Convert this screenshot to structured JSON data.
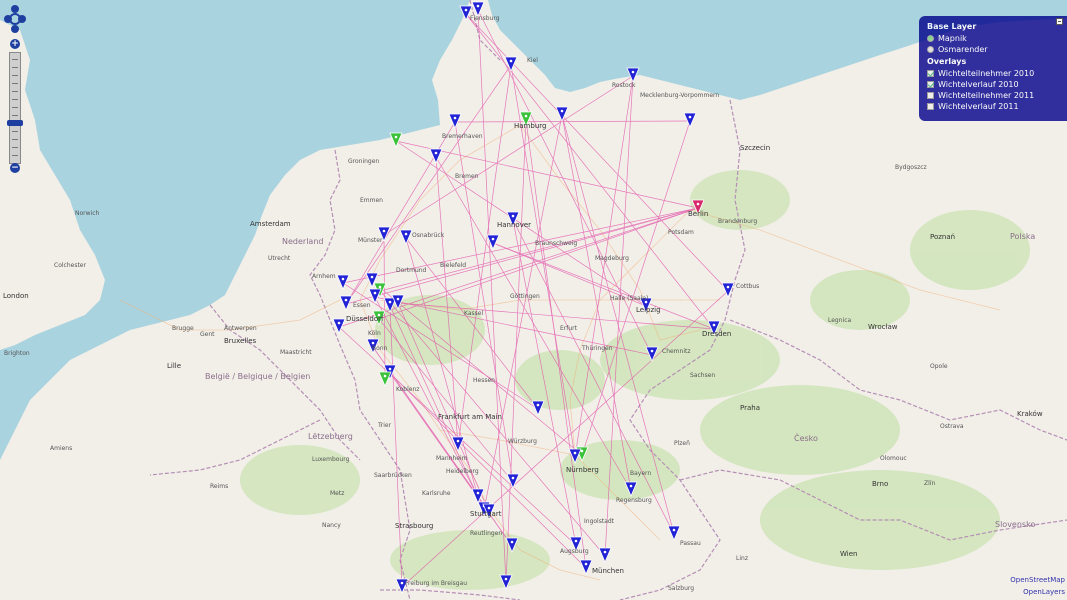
{
  "map": {
    "colors": {
      "water": "#a9d3df",
      "land": "#f2efe9",
      "forest": "#cbe3b2",
      "border": "#b58fb5",
      "route": "#e24fa8",
      "marker_blue": "#2323d6",
      "marker_green": "#3ac23a",
      "marker_red": "#d6286a"
    },
    "labels": {
      "flensburg": "Flensburg",
      "kiel": "Kiel",
      "rostock": "Rostock",
      "mecklenburg": "Mecklenburg-Vorpommern",
      "hamburg": "Hamburg",
      "bremerhaven": "Bremerhaven",
      "bremen": "Bremen",
      "groningen": "Groningen",
      "emmen": "Emmen",
      "amsterdam": "Amsterdam",
      "nederland": "Nederland",
      "utrecht": "Utrecht",
      "hannover": "Hannover",
      "berlin": "Berlin",
      "potsdam": "Potsdam",
      "brandenburg": "Brandenburg",
      "szczecin": "Szczecin",
      "bydgoszcz": "Bydgoszcz",
      "poznan": "Poznań",
      "polska": "Polska",
      "braunschweig": "Braunschweig",
      "dortmund": "Dortmund",
      "essen": "Essen",
      "dusseldorf": "Düsseldorf",
      "koln": "Köln",
      "bonn": "Bonn",
      "koblenz": "Koblenz",
      "kassel": "Kassel",
      "halle": "Halle (Saale)",
      "leipzig": "Leipzig",
      "dresden": "Dresden",
      "chemnitz": "Chemnitz",
      "cottbus": "Cottbus",
      "wroclaw": "Wrocław",
      "frankfurt": "Frankfurt am Main",
      "wurzburg": "Würzburg",
      "nurnberg": "Nürnberg",
      "mannheim": "Mannheim",
      "heidelberg": "Heidelberg",
      "stuttgart": "Stuttgart",
      "reutlingen": "Reutlingen",
      "augsburg": "Augsburg",
      "munchen": "München",
      "ingolstadt": "Ingolstadt",
      "praha": "Praha",
      "cesko": "Česko",
      "brno": "Brno",
      "wien": "Wien",
      "linz": "Linz",
      "salzburg": "Salzburg",
      "krakow": "Kraków",
      "ostrava": "Ostrava",
      "slovensko": "Slovensko",
      "london": "London",
      "norwich": "Norwich",
      "colchester": "Colchester",
      "brighton": "Brighton",
      "antwerpen": "Antwerpen",
      "bruxelles": "Bruxelles",
      "belgie": "België / Belgique / Belgien",
      "lille": "Lille",
      "luxembourg": "Luxembourg",
      "letzebuerg": "Lëtzebuerg",
      "strasbourg": "Strasbourg",
      "freiburg": "Freiburg im Breisgau",
      "metz": "Metz",
      "nancy": "Nancy",
      "reims": "Reims",
      "amiens": "Amiens",
      "brugge": "Brugge",
      "gent": "Gent",
      "maastricht": "Maastricht",
      "arnhem": "Arnhem",
      "osnabruck": "Osnabrück",
      "munster": "Münster",
      "bielefeld": "Bielefeld",
      "gottingen": "Göttingen",
      "magdeburg": "Magdeburg",
      "erfurt": "Erfurt",
      "thuringen": "Thüringen",
      "sachsen": "Sachsen",
      "hessen": "Hessen",
      "bayern": "Bayern",
      "plzen": "Plzeň",
      "legnica": "Legnica",
      "opole": "Opole",
      "olomouc": "Olomouc",
      "zlin": "Zlín",
      "trier": "Trier",
      "saarbrucken": "Saarbrücken",
      "karlsruhe": "Karlsruhe",
      "regensburg": "Regensburg",
      "passau": "Passau"
    }
  },
  "controls": {
    "zoom_in": "+",
    "zoom_out": "−"
  },
  "layer_switcher": {
    "base_title": "Base Layer",
    "base_layers": [
      {
        "label": "Mapnik",
        "selected": true
      },
      {
        "label": "Osmarender",
        "selected": false
      }
    ],
    "overlays_title": "Overlays",
    "overlays": [
      {
        "label": "Wichtelteilnehmer 2010",
        "checked": true
      },
      {
        "label": "Wichtelverlauf 2010",
        "checked": true
      },
      {
        "label": "Wichtelteilnehmer 2011",
        "checked": false
      },
      {
        "label": "Wichtelverlauf 2011",
        "checked": false
      }
    ]
  },
  "attribution": {
    "line1": "OpenStreetMap",
    "line2": "OpenLayers"
  }
}
